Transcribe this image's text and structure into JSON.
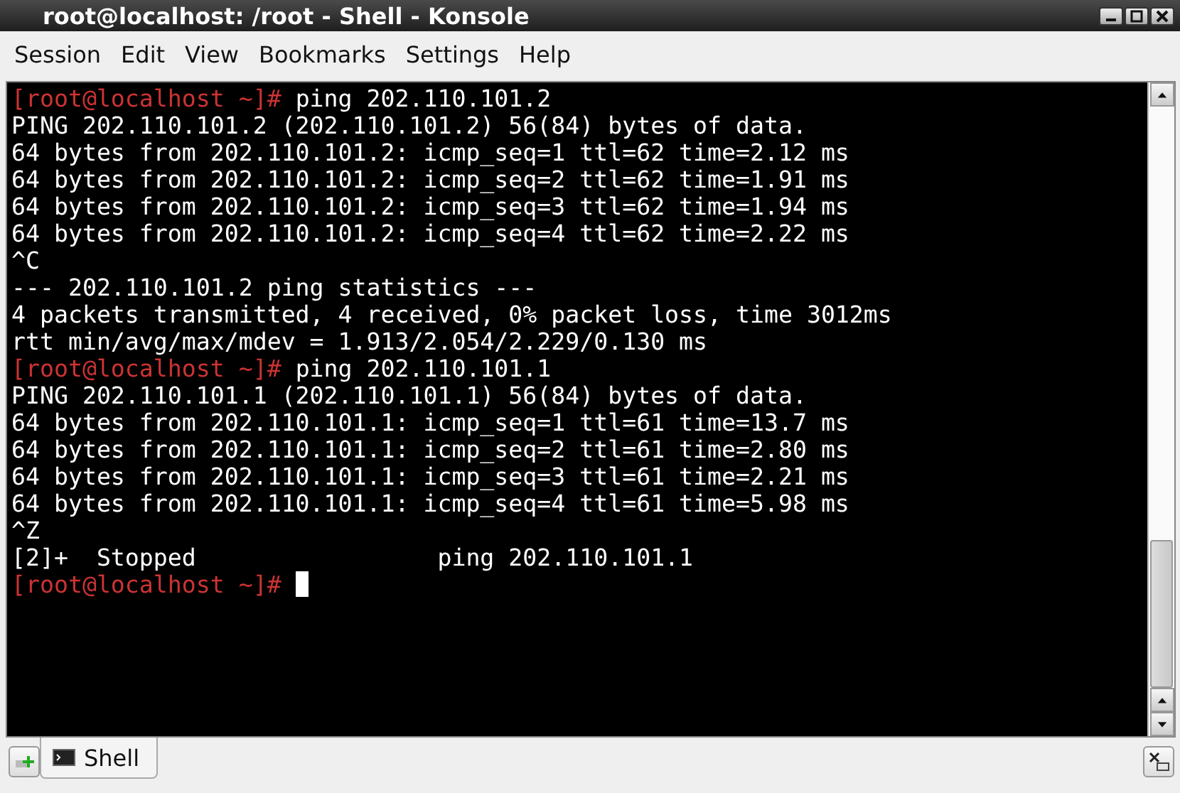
{
  "window": {
    "title": "root@localhost: /root - Shell - Konsole"
  },
  "menu": [
    "Session",
    "Edit",
    "View",
    "Bookmarks",
    "Settings",
    "Help"
  ],
  "terminal": {
    "lines": [
      {
        "prompt": "[root@localhost ~]# ",
        "text": "ping 202.110.101.2"
      },
      {
        "text": "PING 202.110.101.2 (202.110.101.2) 56(84) bytes of data."
      },
      {
        "text": "64 bytes from 202.110.101.2: icmp_seq=1 ttl=62 time=2.12 ms"
      },
      {
        "text": "64 bytes from 202.110.101.2: icmp_seq=2 ttl=62 time=1.91 ms"
      },
      {
        "text": "64 bytes from 202.110.101.2: icmp_seq=3 ttl=62 time=1.94 ms"
      },
      {
        "text": "64 bytes from 202.110.101.2: icmp_seq=4 ttl=62 time=2.22 ms"
      },
      {
        "text": "^C"
      },
      {
        "text": "--- 202.110.101.2 ping statistics ---"
      },
      {
        "text": "4 packets transmitted, 4 received, 0% packet loss, time 3012ms"
      },
      {
        "text": "rtt min/avg/max/mdev = 1.913/2.054/2.229/0.130 ms"
      },
      {
        "prompt": "[root@localhost ~]# ",
        "text": "ping 202.110.101.1"
      },
      {
        "text": "PING 202.110.101.1 (202.110.101.1) 56(84) bytes of data."
      },
      {
        "text": "64 bytes from 202.110.101.1: icmp_seq=1 ttl=61 time=13.7 ms"
      },
      {
        "text": "64 bytes from 202.110.101.1: icmp_seq=2 ttl=61 time=2.80 ms"
      },
      {
        "text": "64 bytes from 202.110.101.1: icmp_seq=3 ttl=61 time=2.21 ms"
      },
      {
        "text": "64 bytes from 202.110.101.1: icmp_seq=4 ttl=61 time=5.98 ms"
      },
      {
        "text": "^Z"
      },
      {
        "text": "[2]+  Stopped                 ping 202.110.101.1"
      },
      {
        "prompt": "[root@localhost ~]# ",
        "cursor": true
      }
    ]
  },
  "tabs": [
    {
      "label": "Shell",
      "selected": true
    }
  ]
}
